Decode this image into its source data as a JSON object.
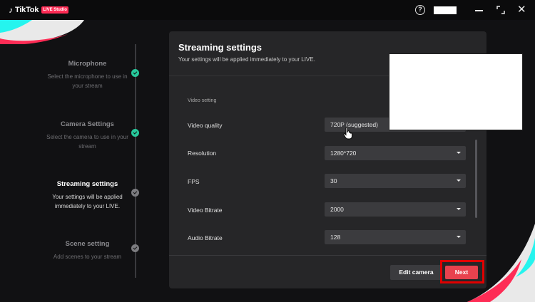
{
  "app": {
    "logo_text": "TikTok",
    "logo_badge": "LIVE Studio"
  },
  "titlebar": {
    "help_icon": "?",
    "close_glyph": "✕"
  },
  "steps": [
    {
      "title": "Microphone",
      "desc": "Select the microphone to use in your stream",
      "status": "done"
    },
    {
      "title": "Camera Settings",
      "desc": "Select the camera to use in your stream",
      "status": "done"
    },
    {
      "title": "Streaming settings",
      "desc": "Your settings will be applied immediately to your LIVE.",
      "status": "active"
    },
    {
      "title": "Scene setting",
      "desc": "Add scenes to your stream",
      "status": "pending"
    }
  ],
  "dialog": {
    "title": "Streaming settings",
    "subtitle": "Your settings will be applied immediately to your LIVE.",
    "section_label": "Video setting",
    "rows": [
      {
        "label": "Video quality",
        "value": "720P (suggested)"
      },
      {
        "label": "Resolution",
        "value": "1280*720"
      },
      {
        "label": "FPS",
        "value": "30"
      },
      {
        "label": "Video Bitrate",
        "value": "2000"
      },
      {
        "label": "Audio Bitrate",
        "value": "128"
      }
    ],
    "edit_camera_label": "Edit camera",
    "next_label": "Next"
  },
  "colors": {
    "accent": "#fe2c55",
    "done": "#27c99c",
    "highlight_frame": "#e00000"
  }
}
